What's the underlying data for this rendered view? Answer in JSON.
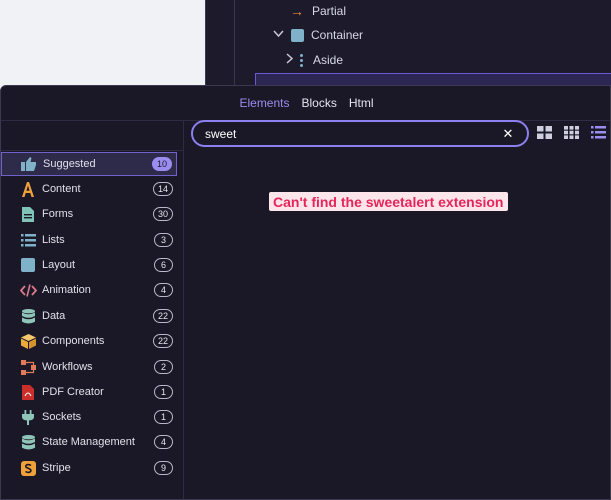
{
  "tree": {
    "items": [
      {
        "label": "Partial"
      },
      {
        "label": "Container"
      },
      {
        "label": "Aside"
      }
    ]
  },
  "tabs": [
    {
      "label": "Elements",
      "active": true
    },
    {
      "label": "Blocks"
    },
    {
      "label": "Html"
    }
  ],
  "search": {
    "value": "sweet"
  },
  "sidebar": {
    "items": [
      {
        "label": "Suggested",
        "count": "10",
        "icon": "thumbs-up-icon",
        "selected": true
      },
      {
        "label": "Content",
        "count": "14",
        "icon": "letter-a-icon"
      },
      {
        "label": "Forms",
        "count": "30",
        "icon": "document-icon"
      },
      {
        "label": "Lists",
        "count": "3",
        "icon": "list-icon"
      },
      {
        "label": "Layout",
        "count": "6",
        "icon": "square-icon"
      },
      {
        "label": "Animation",
        "count": "4",
        "icon": "code-icon"
      },
      {
        "label": "Data",
        "count": "22",
        "icon": "database-icon"
      },
      {
        "label": "Components",
        "count": "22",
        "icon": "box-icon"
      },
      {
        "label": "Workflows",
        "count": "2",
        "icon": "workflow-icon"
      },
      {
        "label": "PDF Creator",
        "count": "1",
        "icon": "pdf-icon"
      },
      {
        "label": "Sockets",
        "count": "1",
        "icon": "plug-icon"
      },
      {
        "label": "State Management",
        "count": "4",
        "icon": "database-icon"
      },
      {
        "label": "Stripe",
        "count": "9",
        "icon": "stripe-icon"
      }
    ]
  },
  "annotation": "Can't find the sweetalert extension",
  "colors": {
    "accent": "#9b8cf0",
    "annotation": "#e5265a"
  }
}
